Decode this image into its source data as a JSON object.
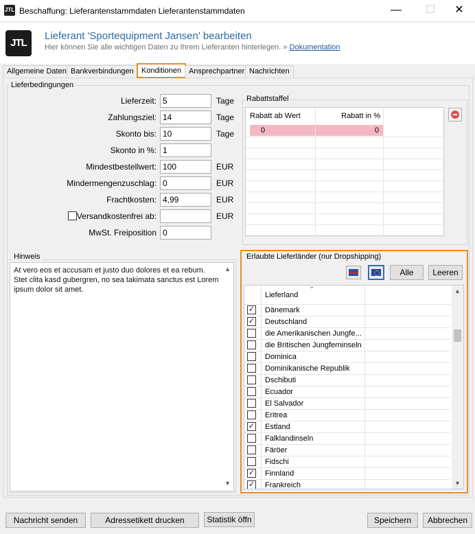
{
  "window": {
    "title": "Beschaffung: Lieferantenstammdaten Lieferantenstammdaten",
    "icon_text": "JTL",
    "minimize": "—",
    "maximize": "☐",
    "close": "✕"
  },
  "header": {
    "logo_text": "JTL",
    "title": "Lieferant 'Sportequipment Jansen' bearbeiten",
    "subtitle": "Hier können Sie alle wichtigen Daten zu Ihrem Lieferanten hinterlegen.",
    "doc_prefix": "»",
    "doc_link": "Dokumentation"
  },
  "tabs": [
    {
      "label": "Allgemeine Daten",
      "active": false
    },
    {
      "label": "Bankverbindungen",
      "active": false
    },
    {
      "label": "Konditionen",
      "active": true
    },
    {
      "label": "Ansprechpartner",
      "active": false
    },
    {
      "label": "Nachrichten",
      "active": false
    }
  ],
  "lieferbedingungen": {
    "legend": "Lieferbedingungen",
    "lieferzeit": {
      "label": "Lieferzeit:",
      "value": "5",
      "unit": "Tage"
    },
    "zahlungsziel": {
      "label": "Zahlungsziel:",
      "value": "14",
      "unit": "Tage"
    },
    "skonto_bis": {
      "label": "Skonto bis:",
      "value": "10",
      "unit": "Tage"
    },
    "skonto_in": {
      "label": "Skonto in %:",
      "value": "1"
    },
    "mindestbestellwert": {
      "label": "Mindestbestellwert:",
      "value": "100",
      "unit": "EUR"
    },
    "mindermengenzuschlag": {
      "label": "Mindermengenzuschlag:",
      "value": "0",
      "unit": "EUR"
    },
    "frachtkosten": {
      "label": "Frachtkosten:",
      "value": "4,99",
      "unit": "EUR"
    },
    "versandkostenfrei": {
      "label": "Versandkostenfrei ab:",
      "value": "",
      "unit": "EUR",
      "checked": false
    },
    "mwst_freiposition": {
      "label": "MwSt. Freiposition",
      "value": "0"
    }
  },
  "rabattstaffel": {
    "legend": "Rabattstaffel",
    "col_wert": "Rabatt ab Wert",
    "col_prozent": "Rabatt in %",
    "row_wert": "0",
    "row_prozent": "0"
  },
  "hinweis": {
    "legend": "Hinweis",
    "text": "At vero eos et accusam et justo duo dolores et ea rebum. Stet clita kasd gubergren, no sea takimata sanctus est Lorem ipsum dolor sit amet."
  },
  "lieferlaender": {
    "legend": "Erlaubte Lieferländer (nur Dropshipping)",
    "btn_alle": "Alle",
    "btn_leeren": "Leeren",
    "col_header": "Lieferland",
    "sort_glyph": "⌄",
    "countries": [
      {
        "name": "Dänemark",
        "checked": true
      },
      {
        "name": "Deutschland",
        "checked": true
      },
      {
        "name": "die Amerikanischen Jungfe...",
        "checked": false
      },
      {
        "name": "die Britischen Jungferninseln",
        "checked": false
      },
      {
        "name": "Dominica",
        "checked": false
      },
      {
        "name": "Dominikanische Republik",
        "checked": false
      },
      {
        "name": "Dschibuti",
        "checked": false
      },
      {
        "name": "Ecuador",
        "checked": false
      },
      {
        "name": "El Salvador",
        "checked": false
      },
      {
        "name": "Eritrea",
        "checked": false
      },
      {
        "name": "Estland",
        "checked": true
      },
      {
        "name": "Falklandinseln",
        "checked": false
      },
      {
        "name": "Färöer",
        "checked": false
      },
      {
        "name": "Fidschi",
        "checked": false
      },
      {
        "name": "Finnland",
        "checked": true
      },
      {
        "name": "Frankreich",
        "checked": true
      }
    ]
  },
  "footer": {
    "nachricht_senden": "Nachricht senden",
    "adressetikett": "Adressetikett drucken",
    "statistik": "Statistik öffn",
    "speichern": "Speichern",
    "abbrechen": "Abbrechen"
  },
  "check_glyph": "✓",
  "colors": {
    "accent_orange": "#f08a24",
    "header_blue": "#2d6aa6",
    "pink_row": "#f5b7c4"
  }
}
